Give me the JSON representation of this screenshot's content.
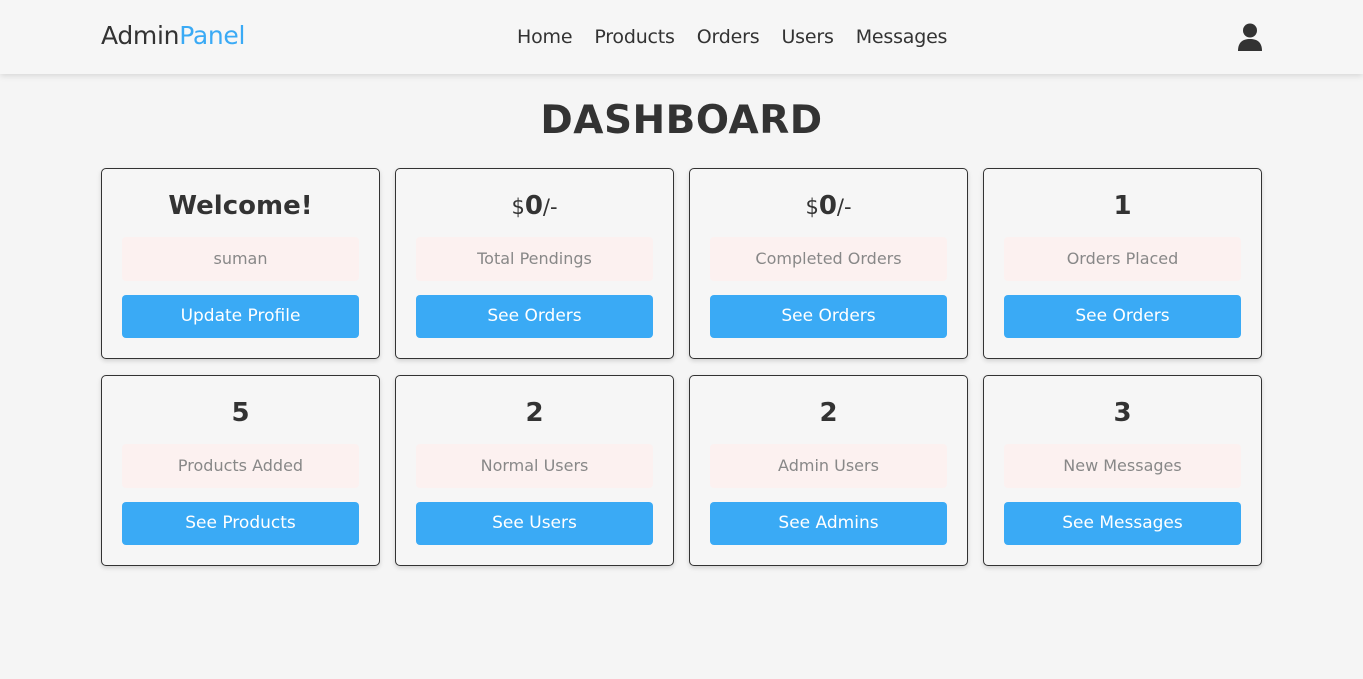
{
  "header": {
    "logo_main": "Admin",
    "logo_accent": "Panel",
    "nav": [
      "Home",
      "Products",
      "Orders",
      "Users",
      "Messages"
    ],
    "user_icon": "user-icon"
  },
  "page_title": "DASHBOARD",
  "cards": [
    {
      "value": "Welcome!",
      "label": "suman",
      "button": "Update Profile"
    },
    {
      "value_prefix": "$",
      "value": "0",
      "value_suffix": "/-",
      "label": "Total Pendings",
      "button": "See Orders"
    },
    {
      "value_prefix": "$",
      "value": "0",
      "value_suffix": "/-",
      "label": "Completed Orders",
      "button": "See Orders"
    },
    {
      "value": "1",
      "label": "Orders Placed",
      "button": "See Orders"
    },
    {
      "value": "5",
      "label": "Products Added",
      "button": "See Products"
    },
    {
      "value": "2",
      "label": "Normal Users",
      "button": "See Users"
    },
    {
      "value": "2",
      "label": "Admin Users",
      "button": "See Admins"
    },
    {
      "value": "3",
      "label": "New Messages",
      "button": "See Messages"
    }
  ],
  "colors": {
    "accent": "#3aaaf5",
    "label_bg": "#fcf1f0",
    "background": "#f5f5f5"
  }
}
